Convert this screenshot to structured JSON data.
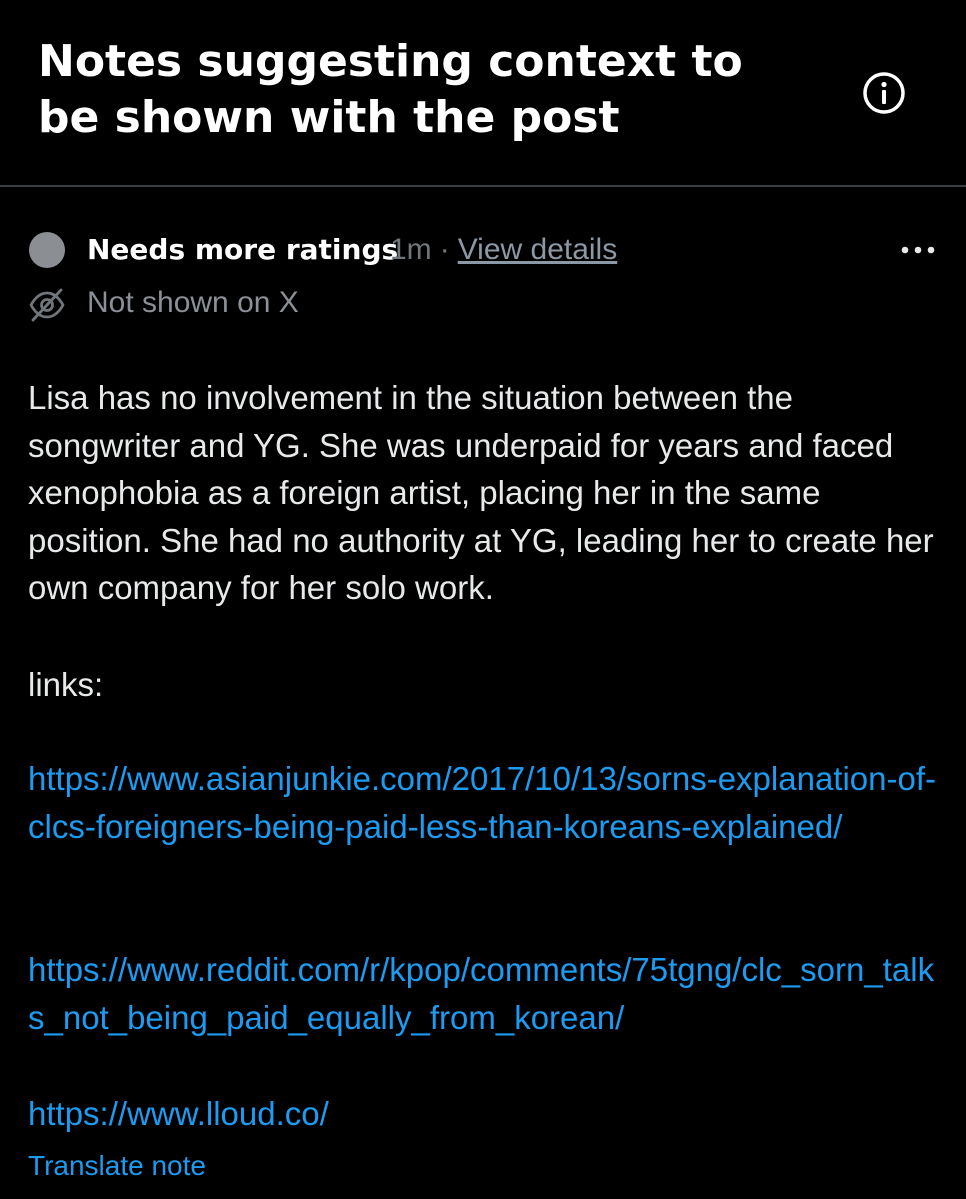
{
  "header": {
    "title": "Notes suggesting context to be shown with the post",
    "info_icon": "info-circle-icon"
  },
  "note": {
    "status": "Needs more ratings",
    "timestamp": "1m",
    "separator": "·",
    "view_details_label": "View details",
    "more_icon": "more-horizontal-icon",
    "visibility_icon": "eye-off-icon",
    "visibility_label": "Not shown on X",
    "body": "Lisa has no involvement in the situation between the songwriter and YG. She was underpaid for years and faced xenophobia as a foreign artist, placing her in the same position. She had no authority at YG, leading her to create her own company for her solo work.",
    "links_label": "links:",
    "links": [
      "https://www.asianjunkie.com/2017/10/13/sorns-explanation-of-clcs-foreigners-being-paid-less-than-koreans-explained/",
      "https://www.reddit.com/r/kpop/comments/75tgng/clc_sorn_talks_not_being_paid_equally_from_korean/",
      "https://www.lloud.co/"
    ],
    "translate_label": "Translate note"
  },
  "colors": {
    "background": "#000000",
    "text": "#e7e9ea",
    "muted": "#71767b",
    "link": "#1d9bf0",
    "status_dot": "#8b8f94",
    "divider": "#3a3d41"
  }
}
